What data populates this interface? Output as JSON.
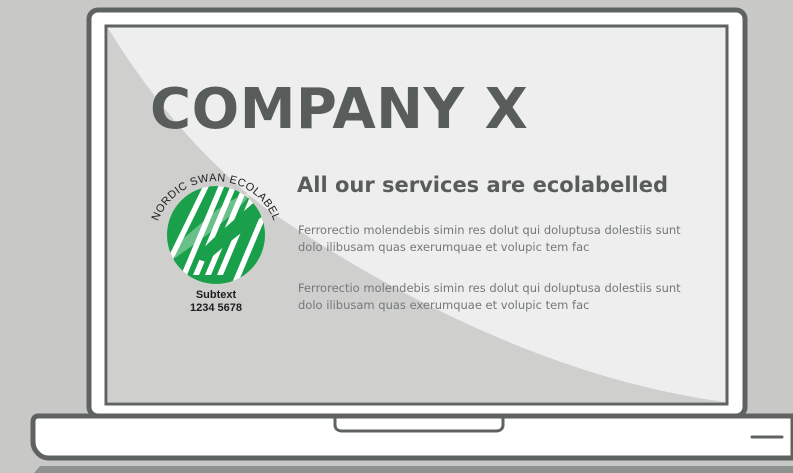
{
  "screen": {
    "company_name": "COMPANY X",
    "headline": "All our services are ecolabelled",
    "paragraphs": [
      "Ferrorectio molendebis simin res dolut qui doluptusa dolestiis sunt dolo ilibusam quas exerumquae et volupic tem fac",
      "Ferrorectio molendebis simin res dolut qui doluptusa dolestiis sunt dolo ilibusam quas exerumquae et volupic tem fac"
    ]
  },
  "ecolabel": {
    "arc_text": "NORDIC SWAN ECOLABEL",
    "subtext": "Subtext",
    "number": "1234 5678"
  },
  "colors": {
    "background": "#c8c9c7",
    "laptop_frame": "#5e6362",
    "screen_white": "#eeeeef",
    "screen_gray": "#cfd0ce",
    "ecolabel_green": "#1aa04b",
    "title_text": "#585d5c"
  }
}
